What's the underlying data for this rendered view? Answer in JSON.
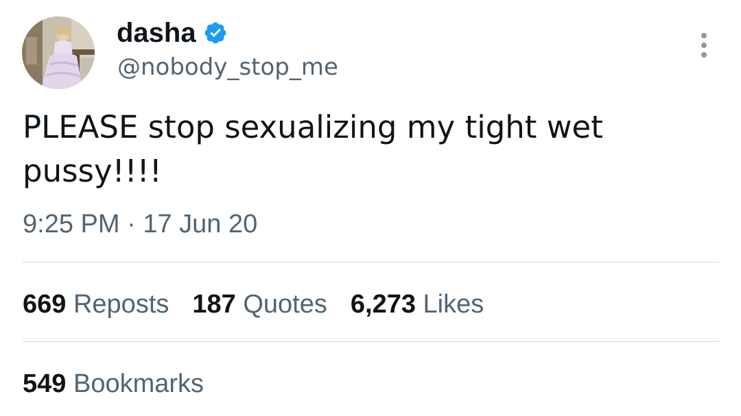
{
  "user": {
    "display_name": "dasha",
    "handle": "@nobody_stop_me",
    "verified_icon": "verified-badge-icon",
    "avatar": "profile-photo"
  },
  "tweet": {
    "text": "PLEASE stop sexualizing my tight wet\npussy!!!!",
    "time": "9:25 PM",
    "separator": "·",
    "date": "17 Jun 20"
  },
  "stats": [
    {
      "count": "669",
      "label": "Reposts"
    },
    {
      "count": "187",
      "label": "Quotes"
    },
    {
      "count": "6,273",
      "label": "Likes"
    }
  ],
  "bookmarks": {
    "count": "549",
    "label": "Bookmarks"
  },
  "colors": {
    "text_primary": "#0f1419",
    "text_secondary": "#536471",
    "verified_blue": "#1d9bf0",
    "divider": "#cfd9de"
  },
  "icons": {
    "more": "more-options-icon"
  }
}
